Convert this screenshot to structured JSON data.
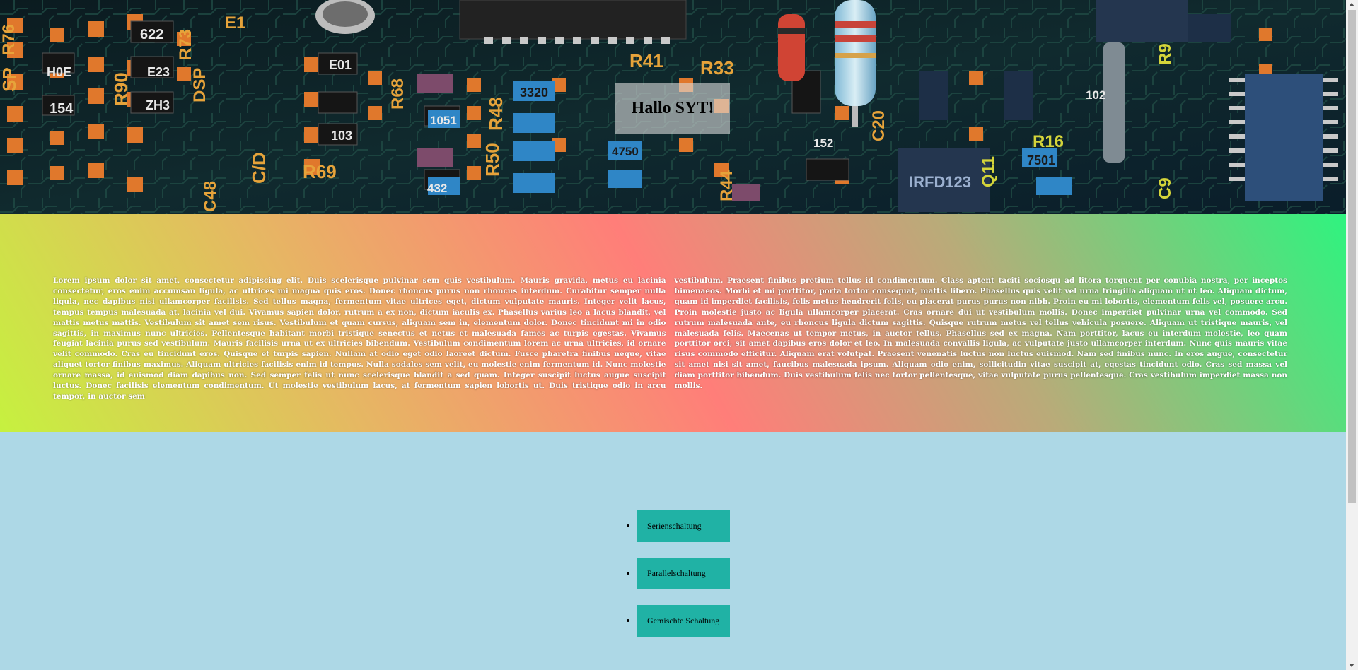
{
  "hero": {
    "title": "Hallo SYT!",
    "image": "circuit-board-photo",
    "board_labels": [
      "SP",
      "R76",
      "622",
      "R73",
      "E1",
      "H0E",
      "E23",
      "R90",
      "DSP",
      "154",
      "ZH3",
      "R68",
      "E01",
      "103",
      "3320",
      "1051",
      "4750",
      "R41",
      "R33",
      "R48",
      "R50",
      "432",
      "R69",
      "C48",
      "C/D",
      "R44",
      "152",
      "C20",
      "Q11",
      "R16",
      "7501",
      "IRFD123",
      "R9",
      "C9",
      "102"
    ]
  },
  "content": {
    "column_left": "Lorem ipsum dolor sit amet, consectetur adipiscing elit. Duis scelerisque pulvinar sem quis vestibulum. Mauris gravida, metus eu lacinia consectetur, eros enim accumsan ligula, ac ultrices mi magna quis eros. Donec rhoncus purus non rhoncus interdum. Curabitur semper nulla ligula, nec dapibus nisi ullamcorper facilisis. Sed tellus magna, fermentum vitae ultrices eget, dictum vulputate mauris. Integer velit lacus, tempus tempus malesuada at, lacinia vel dui. Vivamus sapien dolor, rutrum a ex non, dictum iaculis ex. Phasellus varius leo a lacus blandit, vel mattis metus mattis. Vestibulum sit amet sem risus. Vestibulum et quam cursus, aliquam sem in, elementum dolor. Donec tincidunt mi in odio sagittis, in maximus nunc ultricies. Pellentesque habitant morbi tristique senectus et netus et malesuada fames ac turpis egestas. Vivamus feugiat lacinia purus sed vestibulum. Mauris facilisis urna ut ex ultricies bibendum. Vestibulum condimentum lorem ac urna ultricies, id ornare velit commodo. Cras eu tincidunt eros. Quisque et turpis sapien. Nullam at odio eget odio laoreet dictum. Fusce pharetra finibus neque, vitae aliquet tortor finibus maximus. Aliquam ultricies facilisis enim id tempus. Nulla sodales sem velit, eu molestie enim fermentum id. Nunc molestie ornare massa, id euismod diam dapibus non. Sed semper felis ut nunc scelerisque blandit a sed quam. Integer suscipit luctus augue suscipit luctus. Donec facilisis elementum condimentum. Ut molestie vestibulum lacus, at fermentum sapien lobortis ut. Duis tristique odio in arcu tempor, in auctor sem",
    "column_right": "vestibulum. Praesent finibus pretium tellus id condimentum. Class aptent taciti sociosqu ad litora torquent per conubia nostra, per inceptos himenaeos. Morbi et mi porttitor, porta tortor consequat, mattis libero. Phasellus quis velit vel urna fringilla aliquam ut ut leo. Aliquam dictum, quam id imperdiet facilisis, felis metus hendrerit felis, eu placerat purus purus non nibh. Proin eu mi lobortis, elementum felis vel, posuere arcu. Proin molestie justo ac ligula ullamcorper placerat. Cras ornare dui ut vestibulum mollis. Donec imperdiet pulvinar urna vel commodo. Sed rutrum malesuada ante, eu rhoncus ligula dictum sagittis. Quisque rutrum metus vel tellus vehicula posuere. Aliquam ut tristique mauris, vel malesuada felis. Maecenas ut tempor metus, in auctor tellus. Phasellus sed ex magna. Nam porttitor, lacus eu interdum molestie, leo quam porttitor orci, sit amet dapibus eros dolor et leo. In malesuada convallis ligula, ac vulputate justo ullamcorper interdum. Nunc quis mauris vitae risus commodo efficitur. Aliquam erat volutpat. Praesent venenatis luctus non luctus euismod. Nam sed finibus nunc. In eros augue, consectetur sit amet nisi sit amet, faucibus malesuada ipsum. Aliquam odio enim, sollicitudin vitae suscipit at, egestas tincidunt odio. Cras sed massa vel diam porttitor bibendum. Duis vestibulum felis nec tortor pellentesque, vitae vulputate purus pellentesque. Cras vestibulum imperdiet massa non mollis."
  },
  "links": [
    {
      "label": "Serienschaltung"
    },
    {
      "label": "Parallelschaltung"
    },
    {
      "label": "Gemischte Schaltung"
    }
  ],
  "colors": {
    "list_background": "#add8e6",
    "button_background": "#20b2a5",
    "gradient": [
      "#c6f13f",
      "#e6b763",
      "#ff7e79",
      "#b9ab79",
      "#2ff37f"
    ]
  }
}
